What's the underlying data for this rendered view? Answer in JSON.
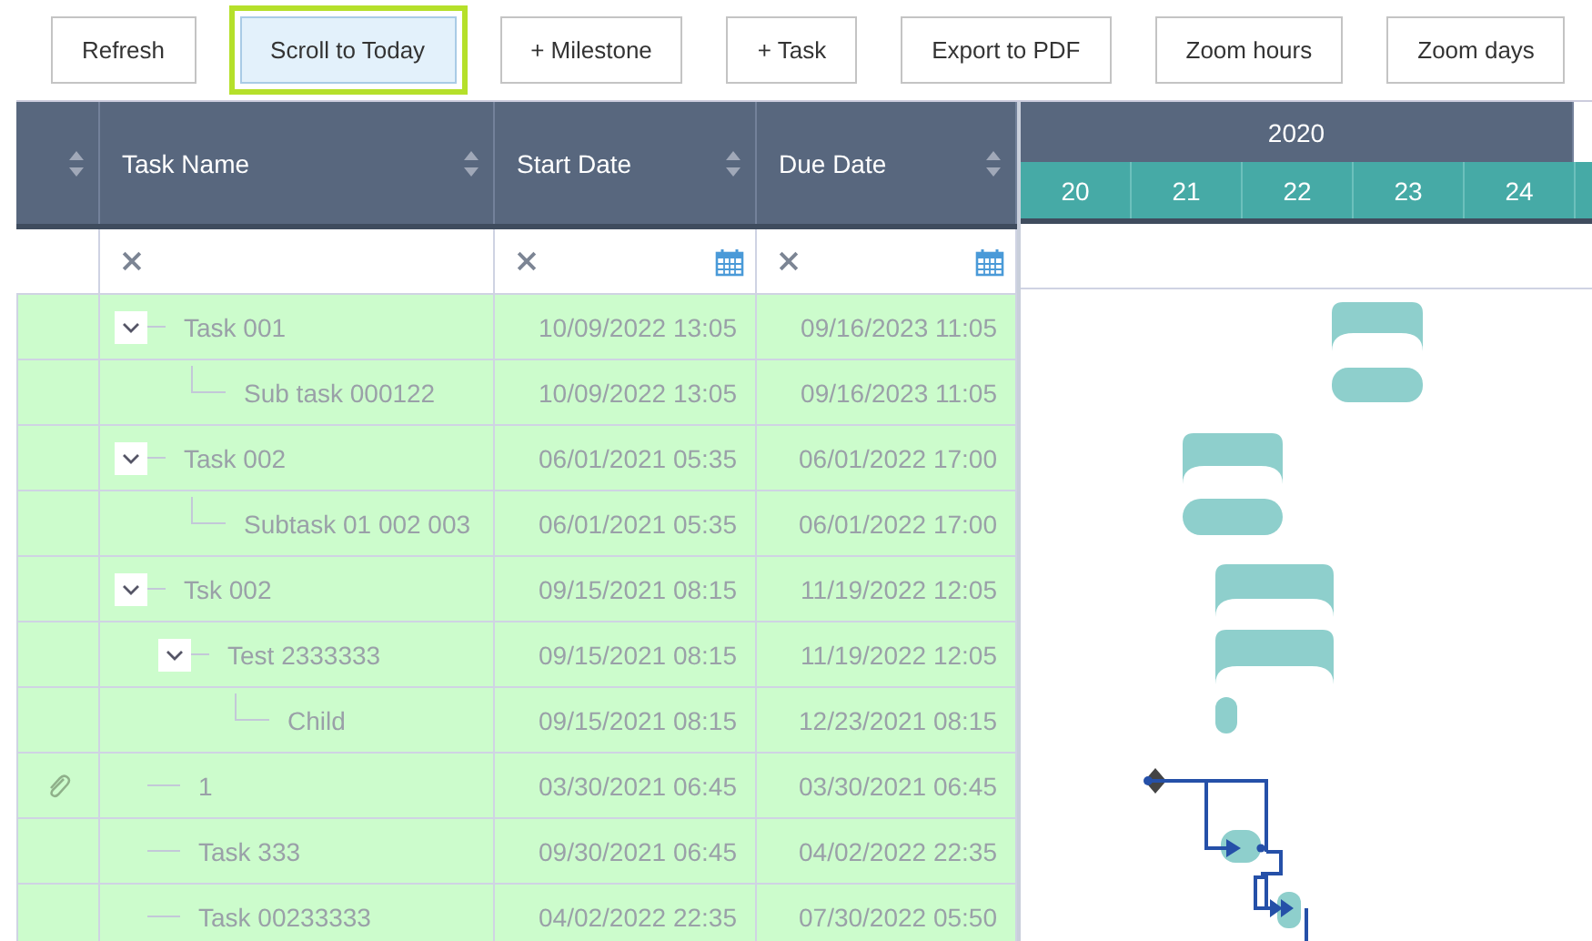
{
  "toolbar": [
    {
      "label": "Refresh",
      "focused": false
    },
    {
      "label": "Scroll to Today",
      "focused": true
    },
    {
      "label": "+ Milestone",
      "focused": false
    },
    {
      "label": "+ Task",
      "focused": false
    },
    {
      "label": "Export to PDF",
      "focused": false
    },
    {
      "label": "Zoom hours",
      "focused": false
    },
    {
      "label": "Zoom days",
      "focused": false
    }
  ],
  "table": {
    "columns": [
      "Task Name",
      "Start Date",
      "Due Date"
    ],
    "rows": [
      {
        "name": "Task 001",
        "start": "10/09/2022 13:05",
        "due": "09/16/2023 11:05",
        "has_attachment": false,
        "expanded": true,
        "children": [
          {
            "name": "Sub task 000122",
            "start": "10/09/2022 13:05",
            "due": "09/16/2023 11:05",
            "has_attachment": false
          }
        ]
      },
      {
        "name": "Task 002",
        "start": "06/01/2021 05:35",
        "due": "06/01/2022 17:00",
        "has_attachment": false,
        "expanded": true,
        "children": [
          {
            "name": "Subtask 01 002 003",
            "start": "06/01/2021 05:35",
            "due": "06/01/2022 17:00",
            "has_attachment": false
          }
        ]
      },
      {
        "name": "Tsk 002",
        "start": "09/15/2021 08:15",
        "due": "11/19/2022 12:05",
        "has_attachment": false,
        "expanded": true,
        "children": [
          {
            "name": "Test 2333333",
            "start": "09/15/2021 08:15",
            "due": "11/19/2022 12:05",
            "has_attachment": false,
            "expanded": true,
            "children": [
              {
                "name": "Child",
                "start": "09/15/2021 08:15",
                "due": "12/23/2021 08:15",
                "has_attachment": false
              }
            ]
          }
        ]
      },
      {
        "name": "1",
        "start": "03/30/2021 06:45",
        "due": "03/30/2021 06:45",
        "has_attachment": true
      },
      {
        "name": "Task 333",
        "start": "09/30/2021 06:45",
        "due": "04/02/2022 22:35",
        "has_attachment": false
      },
      {
        "name": "Task 00233333",
        "start": "04/02/2022 22:35",
        "due": "07/30/2022 05:50",
        "has_attachment": false
      }
    ]
  },
  "timeline": {
    "year": "2020",
    "days": [
      "20",
      "21",
      "22",
      "23",
      "24"
    ]
  }
}
